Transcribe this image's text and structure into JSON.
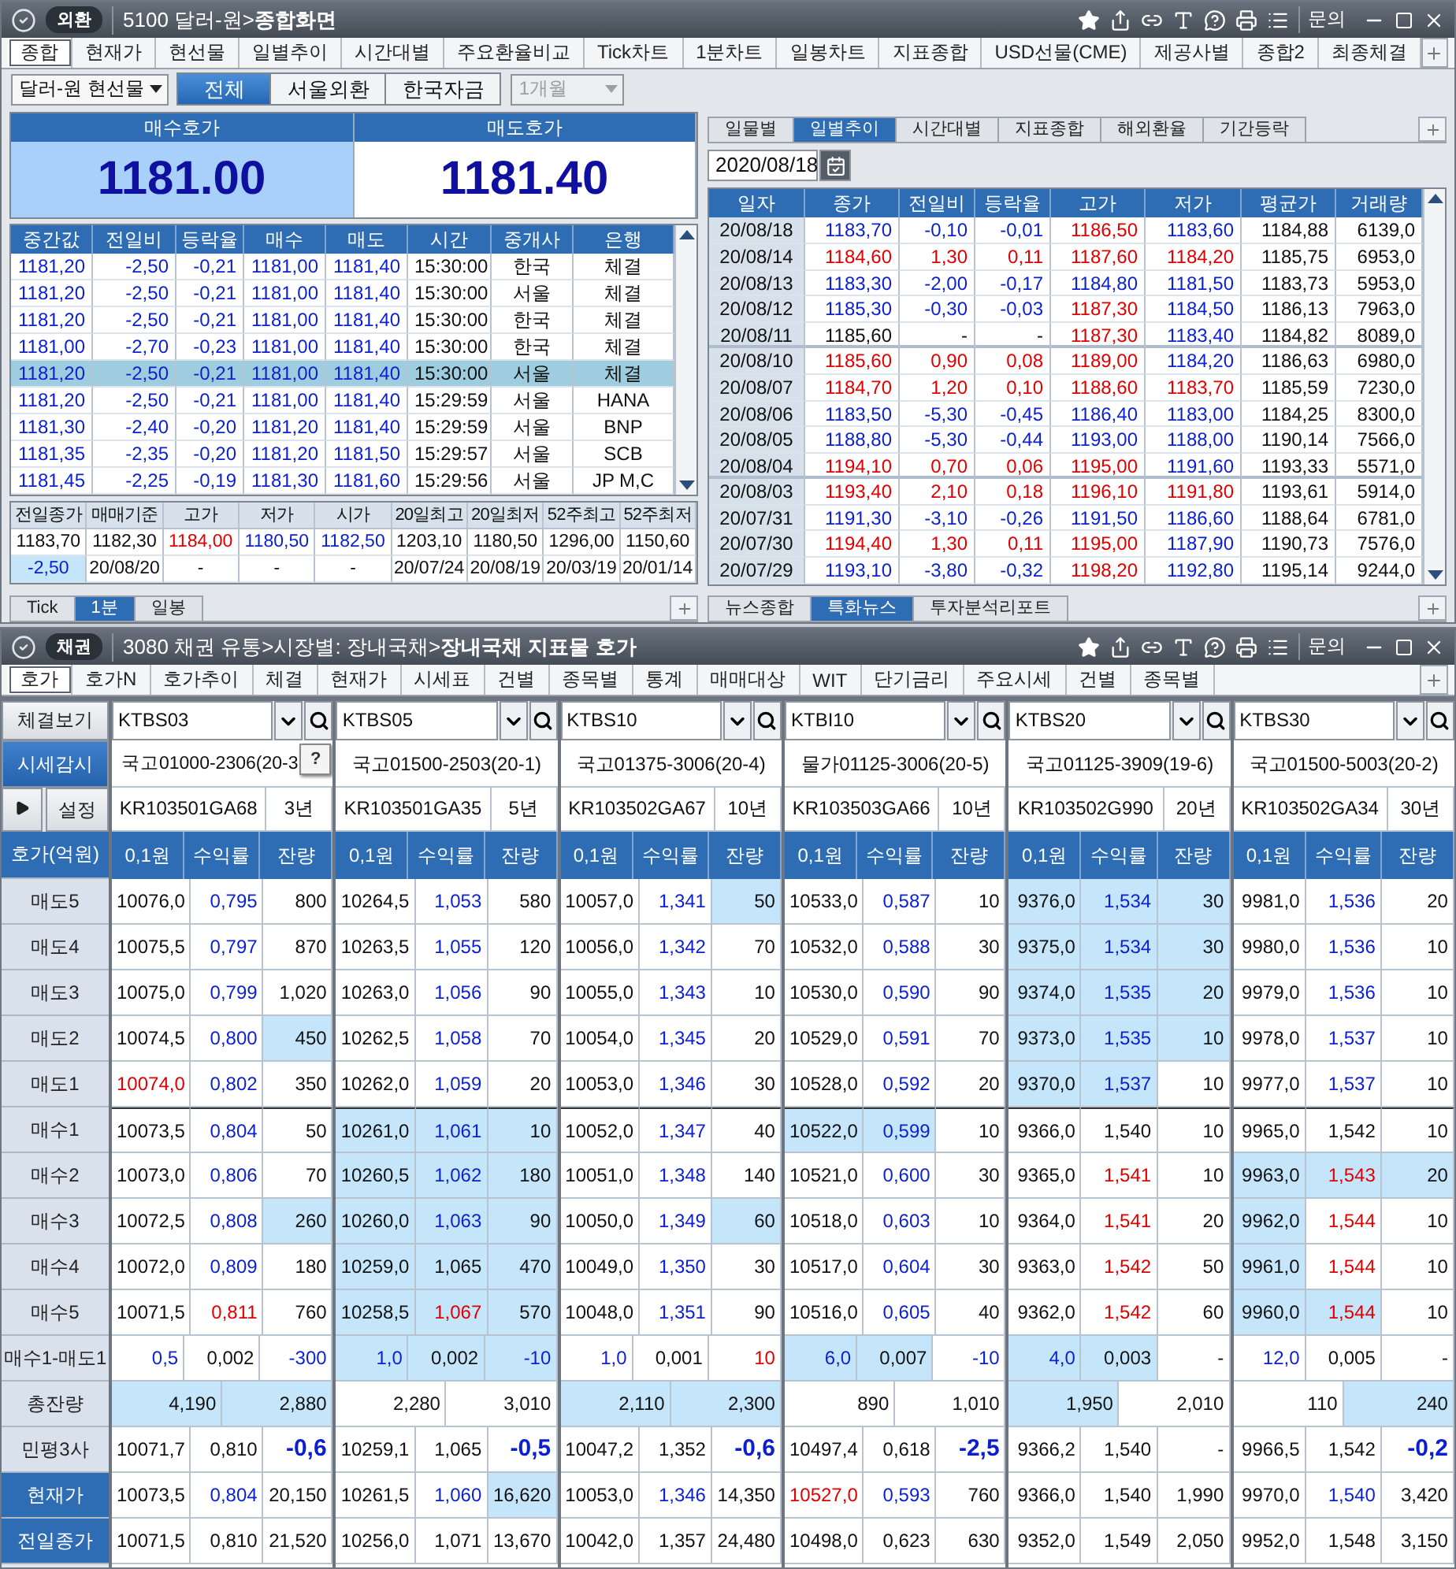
{
  "fx_window": {
    "badge": "외환",
    "title": "5100 달러-원>**종합화면**",
    "inquiry": "문의",
    "tabs": [
      {
        "label": "종합",
        "selected": true
      },
      {
        "label": "현재가",
        "selected": false
      },
      {
        "label": "현선물",
        "selected": false
      },
      {
        "label": "일별추이",
        "selected": false
      },
      {
        "label": "시간대별",
        "selected": false
      },
      {
        "label": "주요환율비교",
        "selected": false
      },
      {
        "label": "Tick차트",
        "selected": false
      },
      {
        "label": "1분차트",
        "selected": false
      },
      {
        "label": "일봉차트",
        "selected": false
      },
      {
        "label": "지표종합",
        "selected": false
      },
      {
        "label": "USD선물(CME)",
        "selected": false
      },
      {
        "label": "제공사별",
        "selected": false
      },
      {
        "label": "종합2",
        "selected": false
      },
      {
        "label": "최종체결",
        "selected": false
      }
    ],
    "instrument": "달러-원 현선물",
    "segments": [
      {
        "label": "전체",
        "selected": true
      },
      {
        "label": "서울외환",
        "selected": false
      },
      {
        "label": "한국자금",
        "selected": false
      }
    ],
    "period": {
      "value": "1개월",
      "disabled": true
    },
    "quotes": [
      {
        "label": "매수호가",
        "value": "1181.00",
        "highlighted": true
      },
      {
        "label": "매도호가",
        "value": "1181.40",
        "highlighted": false
      }
    ],
    "ticks": {
      "columns": [
        {
          "label": "중간값",
          "color": "#0a1fd0"
        },
        {
          "label": "전일비",
          "color": "#0a1fd0"
        },
        {
          "label": "등락율",
          "color": "#0a1fd0"
        },
        {
          "label": "매수",
          "color": "#0a1fd0"
        },
        {
          "label": "매도",
          "color": "#0a1fd0"
        },
        {
          "label": "시간",
          "color": "#111111"
        },
        {
          "label": "중개사",
          "color": "#111111"
        },
        {
          "label": "은행",
          "color": "#111111"
        }
      ],
      "rows": [
        {
          "cells": [
            "1181,20",
            "-2,50",
            "-0,21",
            "1181,00",
            "1181,40",
            "15:30:00",
            "한국",
            "체결"
          ],
          "selected": false
        },
        {
          "cells": [
            "1181,20",
            "-2,50",
            "-0,21",
            "1181,00",
            "1181,40",
            "15:30:00",
            "서울",
            "체결"
          ],
          "selected": false
        },
        {
          "cells": [
            "1181,20",
            "-2,50",
            "-0,21",
            "1181,00",
            "1181,40",
            "15:30:00",
            "한국",
            "체결"
          ],
          "selected": false
        },
        {
          "cells": [
            "1181,00",
            "-2,70",
            "-0,23",
            "1181,00",
            "1181,40",
            "15:30:00",
            "한국",
            "체결"
          ],
          "selected": false
        },
        {
          "cells": [
            "1181,20",
            "-2,50",
            "-0,21",
            "1181,00",
            "1181,40",
            "15:30:00",
            "서울",
            "체결"
          ],
          "selected": true
        },
        {
          "cells": [
            "1181,20",
            "-2,50",
            "-0,21",
            "1181,00",
            "1181,40",
            "15:29:59",
            "서울",
            "HANA"
          ],
          "selected": false
        },
        {
          "cells": [
            "1181,30",
            "-2,40",
            "-0,20",
            "1181,20",
            "1181,40",
            "15:29:59",
            "서울",
            "BNP"
          ],
          "selected": false
        },
        {
          "cells": [
            "1181,35",
            "-2,35",
            "-0,20",
            "1181,20",
            "1181,50",
            "15:29:57",
            "서울",
            "SCB"
          ],
          "selected": false
        },
        {
          "cells": [
            "1181,45",
            "-2,25",
            "-0,19",
            "1181,30",
            "1181,60",
            "15:29:56",
            "서울",
            "JP M,C"
          ],
          "selected": false
        }
      ]
    },
    "summary": {
      "columns": [
        "전일종가",
        "매매기준",
        "고가",
        "저가",
        "시가",
        "20일최고",
        "20일최저",
        "52주최고",
        "52주최저"
      ],
      "rows": [
        [
          "1183,70",
          "1182,30",
          {
            "text": "1184,00",
            "color": "#e00000"
          },
          {
            "text": "1180,50",
            "color": "#0a1fd0"
          },
          {
            "text": "1182,50",
            "color": "#0a1fd0"
          },
          "1203,10",
          "1180,50",
          "1296,00",
          "1150,60"
        ],
        [
          {
            "text": "-2,50",
            "color": "#0a1fd0",
            "highlighted": true
          },
          "20/08/20",
          "-",
          "-",
          "-",
          "20/07/24",
          "20/08/19",
          "20/03/19",
          "20/01/14"
        ]
      ]
    },
    "chart_tabs": [
      {
        "label": "Tick",
        "selected": false
      },
      {
        "label": "1분",
        "selected": true
      },
      {
        "label": "일봉",
        "selected": false
      }
    ],
    "daily": {
      "tabs": [
        {
          "label": "일물별",
          "selected": false
        },
        {
          "label": "일별추이",
          "selected": true
        },
        {
          "label": "시간대별",
          "selected": false
        },
        {
          "label": "지표종합",
          "selected": false
        },
        {
          "label": "해외환율",
          "selected": false
        },
        {
          "label": "기간등락",
          "selected": false
        }
      ],
      "date": "2020/08/18",
      "columns": [
        "일자",
        "종가",
        "전일비",
        "등락율",
        "고가",
        "저가",
        "평균가",
        "거래량"
      ],
      "rows": [
        [
          "20/08/18",
          {
            "text": "1183,70",
            "color": "#0a1fd0"
          },
          {
            "text": "-0,10",
            "color": "#0a1fd0"
          },
          {
            "text": "-0,01",
            "color": "#0a1fd0"
          },
          {
            "text": "1186,50",
            "color": "#e00000"
          },
          {
            "text": "1183,60",
            "color": "#0a1fd0"
          },
          "1184,88",
          "6139,0"
        ],
        [
          "20/08/14",
          {
            "text": "1184,60",
            "color": "#e00000"
          },
          {
            "text": "1,30",
            "color": "#e00000"
          },
          {
            "text": "0,11",
            "color": "#e00000"
          },
          {
            "text": "1187,60",
            "color": "#e00000"
          },
          {
            "text": "1184,20",
            "color": "#e00000"
          },
          "1185,75",
          "6953,0"
        ],
        [
          "20/08/13",
          {
            "text": "1183,30",
            "color": "#0a1fd0"
          },
          {
            "text": "-2,00",
            "color": "#0a1fd0"
          },
          {
            "text": "-0,17",
            "color": "#0a1fd0"
          },
          {
            "text": "1184,80",
            "color": "#0a1fd0"
          },
          {
            "text": "1181,50",
            "color": "#0a1fd0"
          },
          "1183,73",
          "5953,0"
        ],
        [
          "20/08/12",
          {
            "text": "1185,30",
            "color": "#0a1fd0"
          },
          {
            "text": "-0,30",
            "color": "#0a1fd0"
          },
          {
            "text": "-0,03",
            "color": "#0a1fd0"
          },
          {
            "text": "1187,30",
            "color": "#e00000"
          },
          {
            "text": "1184,50",
            "color": "#0a1fd0"
          },
          "1186,13",
          "7963,0"
        ],
        [
          "20/08/11",
          "1185,60",
          "-",
          "-",
          {
            "text": "1187,30",
            "color": "#e00000"
          },
          {
            "text": "1183,40",
            "color": "#0a1fd0"
          },
          "1184,82",
          "8089,0"
        ],
        [
          "20/08/10",
          {
            "text": "1185,60",
            "color": "#e00000"
          },
          {
            "text": "0,90",
            "color": "#e00000"
          },
          {
            "text": "0,08",
            "color": "#e00000"
          },
          {
            "text": "1189,00",
            "color": "#e00000"
          },
          {
            "text": "1184,20",
            "color": "#0a1fd0"
          },
          "1186,63",
          "6980,0"
        ],
        [
          "20/08/07",
          {
            "text": "1184,70",
            "color": "#e00000"
          },
          {
            "text": "1,20",
            "color": "#e00000"
          },
          {
            "text": "0,10",
            "color": "#e00000"
          },
          {
            "text": "1188,60",
            "color": "#e00000"
          },
          {
            "text": "1183,70",
            "color": "#e00000"
          },
          "1185,59",
          "7230,0"
        ],
        [
          "20/08/06",
          {
            "text": "1183,50",
            "color": "#0a1fd0"
          },
          {
            "text": "-5,30",
            "color": "#0a1fd0"
          },
          {
            "text": "-0,45",
            "color": "#0a1fd0"
          },
          {
            "text": "1186,40",
            "color": "#0a1fd0"
          },
          {
            "text": "1183,00",
            "color": "#0a1fd0"
          },
          "1184,25",
          "8300,0"
        ],
        [
          "20/08/05",
          {
            "text": "1188,80",
            "color": "#0a1fd0"
          },
          {
            "text": "-5,30",
            "color": "#0a1fd0"
          },
          {
            "text": "-0,44",
            "color": "#0a1fd0"
          },
          {
            "text": "1193,00",
            "color": "#0a1fd0"
          },
          {
            "text": "1188,00",
            "color": "#0a1fd0"
          },
          "1190,14",
          "7566,0"
        ],
        [
          "20/08/04",
          {
            "text": "1194,10",
            "color": "#e00000"
          },
          {
            "text": "0,70",
            "color": "#e00000"
          },
          {
            "text": "0,06",
            "color": "#e00000"
          },
          {
            "text": "1195,00",
            "color": "#e00000"
          },
          {
            "text": "1191,60",
            "color": "#0a1fd0"
          },
          "1193,33",
          "5571,0"
        ],
        [
          "20/08/03",
          {
            "text": "1193,40",
            "color": "#e00000"
          },
          {
            "text": "2,10",
            "color": "#e00000"
          },
          {
            "text": "0,18",
            "color": "#e00000"
          },
          {
            "text": "1196,10",
            "color": "#e00000"
          },
          {
            "text": "1191,80",
            "color": "#e00000"
          },
          "1193,61",
          "5914,0"
        ],
        [
          "20/07/31",
          {
            "text": "1191,30",
            "color": "#0a1fd0"
          },
          {
            "text": "-3,10",
            "color": "#0a1fd0"
          },
          {
            "text": "-0,26",
            "color": "#0a1fd0"
          },
          {
            "text": "1191,50",
            "color": "#0a1fd0"
          },
          {
            "text": "1186,60",
            "color": "#0a1fd0"
          },
          "1188,64",
          "6781,0"
        ],
        [
          "20/07/30",
          {
            "text": "1194,40",
            "color": "#e00000"
          },
          {
            "text": "1,30",
            "color": "#e00000"
          },
          {
            "text": "0,11",
            "color": "#e00000"
          },
          {
            "text": "1195,00",
            "color": "#e00000"
          },
          {
            "text": "1187,90",
            "color": "#0a1fd0"
          },
          "1190,73",
          "7576,0"
        ],
        [
          "20/07/29",
          {
            "text": "1193,10",
            "color": "#0a1fd0"
          },
          {
            "text": "-3,80",
            "color": "#0a1fd0"
          },
          {
            "text": "-0,32",
            "color": "#0a1fd0"
          },
          {
            "text": "1198,20",
            "color": "#e00000"
          },
          {
            "text": "1192,80",
            "color": "#0a1fd0"
          },
          "1195,14",
          "9244,0"
        ]
      ]
    },
    "news_tabs": [
      {
        "label": "뉴스종합",
        "selected": false
      },
      {
        "label": "특화뉴스",
        "selected": true
      },
      {
        "label": "투자분석리포트",
        "selected": false
      }
    ]
  },
  "bond_window": {
    "badge": "채권",
    "title": "3080 채권 유통>시장별: 장내국채>**장내국채 지표물 호가**",
    "inquiry": "문의",
    "tabs": [
      {
        "label": "호가",
        "selected": true
      },
      {
        "label": "호가N",
        "selected": false
      },
      {
        "label": "호가추이",
        "selected": false
      },
      {
        "label": "체결",
        "selected": false
      },
      {
        "label": "현재가",
        "selected": false
      },
      {
        "label": "시세표",
        "selected": false
      },
      {
        "label": "건별",
        "selected": false
      },
      {
        "label": "종목별",
        "selected": false
      },
      {
        "label": "통계",
        "selected": false
      },
      {
        "label": "매매대상",
        "selected": false
      },
      {
        "label": "WIT",
        "selected": false
      },
      {
        "label": "단기금리",
        "selected": false
      },
      {
        "label": "주요시세",
        "selected": false
      },
      {
        "label": "건별",
        "selected": false
      },
      {
        "label": "종목별",
        "selected": false
      }
    ],
    "trades_button": "체결보기",
    "watch_button": "시세감시",
    "settings_button": "설정",
    "header": "호가(억원)",
    "tooltip": "?",
    "row_labels": [
      {
        "label": "매도5",
        "kind": "label"
      },
      {
        "label": "매도4",
        "kind": "label"
      },
      {
        "label": "매도3",
        "kind": "label"
      },
      {
        "label": "매도2",
        "kind": "label"
      },
      {
        "label": "매도1",
        "kind": "label"
      },
      {
        "label": "매수1",
        "kind": "label"
      },
      {
        "label": "매수2",
        "kind": "label"
      },
      {
        "label": "매수3",
        "kind": "label"
      },
      {
        "label": "매수4",
        "kind": "label"
      },
      {
        "label": "매수5",
        "kind": "label"
      },
      {
        "label": "매수1-매도1",
        "kind": "label"
      },
      {
        "label": "총잔량",
        "kind": "label"
      },
      {
        "label": "민평3사",
        "kind": "label"
      },
      {
        "label": "현재가",
        "kind": "button"
      },
      {
        "label": "전일종가",
        "kind": "button"
      }
    ],
    "columns": [
      {
        "code": "KTBS03",
        "name": "국고01000-2306(20-3",
        "isin": "KR103501GA68",
        "tenor": "3년",
        "headers": [
          "0,1원",
          "수익률",
          "잔량"
        ],
        "totals": [
          {
            "text": "4,190",
            "highlighted": true
          },
          {
            "text": "2,880",
            "highlighted": true
          }
        ],
        "rows": [
          [
            "10076,0",
            {
              "text": "0,795",
              "color": "#0a1fd0"
            },
            "800"
          ],
          [
            "10075,5",
            {
              "text": "0,797",
              "color": "#0a1fd0"
            },
            "870"
          ],
          [
            "10075,0",
            {
              "text": "0,799",
              "color": "#0a1fd0"
            },
            "1,020"
          ],
          [
            "10074,5",
            {
              "text": "0,800",
              "color": "#0a1fd0"
            },
            {
              "text": "450",
              "highlighted": true
            }
          ],
          [
            {
              "text": "10074,0",
              "color": "#e00000"
            },
            {
              "text": "0,802",
              "color": "#0a1fd0"
            },
            "350"
          ],
          [
            "10073,5",
            {
              "text": "0,804",
              "color": "#0a1fd0"
            },
            "50"
          ],
          [
            "10073,0",
            {
              "text": "0,806",
              "color": "#0a1fd0"
            },
            "70"
          ],
          [
            "10072,5",
            {
              "text": "0,808",
              "color": "#0a1fd0"
            },
            {
              "text": "260",
              "highlighted": true
            }
          ],
          [
            "10072,0",
            {
              "text": "0,809",
              "color": "#0a1fd0"
            },
            "180"
          ],
          [
            "10071,5",
            {
              "text": "0,811",
              "color": "#e00000"
            },
            "760"
          ],
          [
            {
              "text": "0,5",
              "color": "#0a1fd0"
            },
            "0,002",
            {
              "text": "-300",
              "color": "#0a1fd0"
            }
          ],
          [
            "10071,7",
            "0,810",
            {
              "text": "-0,6",
              "color": "#0a1fd0",
              "bold": true
            }
          ],
          [
            "10073,5",
            {
              "text": "0,804",
              "color": "#0a1fd0"
            },
            "20,150"
          ],
          [
            "10071,5",
            "0,810",
            "21,520"
          ]
        ]
      },
      {
        "code": "KTBS05",
        "name": "국고01500-2503(20-1)",
        "isin": "KR103501GA35",
        "tenor": "5년",
        "headers": [
          "0,1원",
          "수익률",
          "잔량"
        ],
        "totals": [
          {
            "text": "2,280",
            "highlighted": false
          },
          {
            "text": "3,010",
            "highlighted": false
          }
        ],
        "rows": [
          [
            "10264,5",
            {
              "text": "1,053",
              "color": "#0a1fd0"
            },
            "580"
          ],
          [
            "10263,5",
            {
              "text": "1,055",
              "color": "#0a1fd0"
            },
            "120"
          ],
          [
            "10263,0",
            {
              "text": "1,056",
              "color": "#0a1fd0"
            },
            "90"
          ],
          [
            "10262,5",
            {
              "text": "1,058",
              "color": "#0a1fd0"
            },
            "70"
          ],
          [
            "10262,0",
            {
              "text": "1,059",
              "color": "#0a1fd0"
            },
            "20"
          ],
          [
            {
              "text": "10261,0",
              "highlighted": true
            },
            {
              "text": "1,061",
              "color": "#0a1fd0",
              "highlighted": true
            },
            {
              "text": "10",
              "highlighted": true
            }
          ],
          [
            {
              "text": "10260,5",
              "highlighted": true
            },
            {
              "text": "1,062",
              "color": "#0a1fd0",
              "highlighted": true
            },
            {
              "text": "180",
              "highlighted": true
            }
          ],
          [
            {
              "text": "10260,0",
              "highlighted": true
            },
            {
              "text": "1,063",
              "color": "#0a1fd0",
              "highlighted": true
            },
            {
              "text": "90",
              "highlighted": true
            }
          ],
          [
            {
              "text": "10259,0",
              "highlighted": true
            },
            {
              "text": "1,065",
              "highlighted": true
            },
            {
              "text": "470",
              "highlighted": true
            }
          ],
          [
            {
              "text": "10258,5",
              "highlighted": true
            },
            {
              "text": "1,067",
              "color": "#e00000",
              "highlighted": true
            },
            {
              "text": "570",
              "highlighted": true
            }
          ],
          [
            {
              "text": "1,0",
              "color": "#0a1fd0",
              "highlighted": true
            },
            {
              "text": "0,002",
              "highlighted": true
            },
            {
              "text": "-10",
              "color": "#0a1fd0",
              "highlighted": true
            }
          ],
          [
            "10259,1",
            "1,065",
            {
              "text": "-0,5",
              "color": "#0a1fd0",
              "bold": true
            }
          ],
          [
            "10261,5",
            {
              "text": "1,060",
              "color": "#0a1fd0"
            },
            {
              "text": "16,620",
              "highlighted": true
            }
          ],
          [
            "10256,0",
            "1,071",
            "13,670"
          ]
        ]
      },
      {
        "code": "KTBS10",
        "name": "국고01375-3006(20-4)",
        "isin": "KR103502GA67",
        "tenor": "10년",
        "headers": [
          "0,1원",
          "수익률",
          "잔량"
        ],
        "totals": [
          {
            "text": "2,110",
            "highlighted": true
          },
          {
            "text": "2,300",
            "highlighted": true
          }
        ],
        "rows": [
          [
            "10057,0",
            {
              "text": "1,341",
              "color": "#0a1fd0"
            },
            {
              "text": "50",
              "highlighted": true
            }
          ],
          [
            "10056,0",
            {
              "text": "1,342",
              "color": "#0a1fd0"
            },
            "70"
          ],
          [
            "10055,0",
            {
              "text": "1,343",
              "color": "#0a1fd0"
            },
            "10"
          ],
          [
            "10054,0",
            {
              "text": "1,345",
              "color": "#0a1fd0"
            },
            "20"
          ],
          [
            "10053,0",
            {
              "text": "1,346",
              "color": "#0a1fd0"
            },
            "30"
          ],
          [
            "10052,0",
            {
              "text": "1,347",
              "color": "#0a1fd0"
            },
            "40"
          ],
          [
            "10051,0",
            {
              "text": "1,348",
              "color": "#0a1fd0"
            },
            "140"
          ],
          [
            "10050,0",
            {
              "text": "1,349",
              "color": "#0a1fd0"
            },
            {
              "text": "60",
              "highlighted": true
            }
          ],
          [
            "10049,0",
            {
              "text": "1,350",
              "color": "#0a1fd0"
            },
            "30"
          ],
          [
            "10048,0",
            {
              "text": "1,351",
              "color": "#0a1fd0"
            },
            "90"
          ],
          [
            {
              "text": "1,0",
              "color": "#0a1fd0"
            },
            "0,001",
            {
              "text": "10",
              "color": "#e00000"
            }
          ],
          [
            "10047,2",
            "1,352",
            {
              "text": "-0,6",
              "color": "#0a1fd0",
              "bold": true
            }
          ],
          [
            "10053,0",
            {
              "text": "1,346",
              "color": "#0a1fd0"
            },
            "14,350"
          ],
          [
            "10042,0",
            "1,357",
            "24,480"
          ]
        ]
      },
      {
        "code": "KTBI10",
        "name": "물가01125-3006(20-5)",
        "isin": "KR103503GA66",
        "tenor": "10년",
        "headers": [
          "0,1원",
          "수익률",
          "잔량"
        ],
        "totals": [
          {
            "text": "890",
            "highlighted": false
          },
          {
            "text": "1,010",
            "highlighted": false
          }
        ],
        "rows": [
          [
            "10533,0",
            {
              "text": "0,587",
              "color": "#0a1fd0"
            },
            "10"
          ],
          [
            "10532,0",
            {
              "text": "0,588",
              "color": "#0a1fd0"
            },
            "30"
          ],
          [
            "10530,0",
            {
              "text": "0,590",
              "color": "#0a1fd0"
            },
            "90"
          ],
          [
            "10529,0",
            {
              "text": "0,591",
              "color": "#0a1fd0"
            },
            "70"
          ],
          [
            "10528,0",
            {
              "text": "0,592",
              "color": "#0a1fd0"
            },
            "20"
          ],
          [
            {
              "text": "10522,0",
              "highlighted": true
            },
            {
              "text": "0,599",
              "color": "#0a1fd0",
              "highlighted": true
            },
            "10"
          ],
          [
            "10521,0",
            {
              "text": "0,600",
              "color": "#0a1fd0"
            },
            "30"
          ],
          [
            "10518,0",
            {
              "text": "0,603",
              "color": "#0a1fd0"
            },
            "10"
          ],
          [
            "10517,0",
            {
              "text": "0,604",
              "color": "#0a1fd0"
            },
            "30"
          ],
          [
            "10516,0",
            {
              "text": "0,605",
              "color": "#0a1fd0"
            },
            "40"
          ],
          [
            {
              "text": "6,0",
              "color": "#0a1fd0",
              "highlighted": true
            },
            {
              "text": "0,007",
              "highlighted": true
            },
            {
              "text": "-10",
              "color": "#0a1fd0"
            }
          ],
          [
            "10497,4",
            "0,618",
            {
              "text": "-2,5",
              "color": "#0a1fd0",
              "bold": true
            }
          ],
          [
            {
              "text": "10527,0",
              "color": "#e00000"
            },
            {
              "text": "0,593",
              "color": "#0a1fd0"
            },
            "760"
          ],
          [
            "10498,0",
            "0,623",
            "630"
          ]
        ]
      },
      {
        "code": "KTBS20",
        "name": "국고01125-3909(19-6)",
        "isin": "KR103502G990",
        "tenor": "20년",
        "headers": [
          "0,1원",
          "수익률",
          "잔량"
        ],
        "totals": [
          {
            "text": "1,950",
            "highlighted": true
          },
          {
            "text": "2,010",
            "highlighted": false
          }
        ],
        "rows": [
          [
            {
              "text": "9376,0",
              "highlighted": true
            },
            {
              "text": "1,534",
              "color": "#0a1fd0",
              "highlighted": true
            },
            {
              "text": "30",
              "highlighted": true
            }
          ],
          [
            {
              "text": "9375,0",
              "highlighted": true
            },
            {
              "text": "1,534",
              "color": "#0a1fd0",
              "highlighted": true
            },
            {
              "text": "30",
              "highlighted": true
            }
          ],
          [
            {
              "text": "9374,0",
              "highlighted": true
            },
            {
              "text": "1,535",
              "color": "#0a1fd0",
              "highlighted": true
            },
            {
              "text": "20",
              "highlighted": true
            }
          ],
          [
            {
              "text": "9373,0",
              "highlighted": true
            },
            {
              "text": "1,535",
              "color": "#0a1fd0",
              "highlighted": true
            },
            {
              "text": "10",
              "highlighted": true
            }
          ],
          [
            {
              "text": "9370,0",
              "highlighted": true
            },
            {
              "text": "1,537",
              "color": "#0a1fd0",
              "highlighted": true
            },
            "10"
          ],
          [
            "9366,0",
            "1,540",
            "10"
          ],
          [
            "9365,0",
            {
              "text": "1,541",
              "color": "#e00000"
            },
            "10"
          ],
          [
            "9364,0",
            {
              "text": "1,541",
              "color": "#e00000"
            },
            "20"
          ],
          [
            "9363,0",
            {
              "text": "1,542",
              "color": "#e00000"
            },
            "50"
          ],
          [
            "9362,0",
            {
              "text": "1,542",
              "color": "#e00000"
            },
            "60"
          ],
          [
            {
              "text": "4,0",
              "color": "#0a1fd0",
              "highlighted": true
            },
            {
              "text": "0,003",
              "highlighted": true
            },
            "-"
          ],
          [
            "9366,2",
            "1,540",
            "-"
          ],
          [
            "9366,0",
            "1,540",
            "1,990"
          ],
          [
            "9352,0",
            "1,549",
            "2,050"
          ]
        ]
      },
      {
        "code": "KTBS30",
        "name": "국고01500-5003(20-2)",
        "isin": "KR103502GA34",
        "tenor": "30년",
        "headers": [
          "0,1원",
          "수익률",
          "잔량"
        ],
        "totals": [
          {
            "text": "110",
            "highlighted": false
          },
          {
            "text": "240",
            "highlighted": true
          }
        ],
        "rows": [
          [
            "9981,0",
            {
              "text": "1,536",
              "color": "#0a1fd0"
            },
            "20"
          ],
          [
            "9980,0",
            {
              "text": "1,536",
              "color": "#0a1fd0"
            },
            "10"
          ],
          [
            "9979,0",
            {
              "text": "1,536",
              "color": "#0a1fd0"
            },
            "10"
          ],
          [
            "9978,0",
            {
              "text": "1,537",
              "color": "#0a1fd0"
            },
            "10"
          ],
          [
            "9977,0",
            {
              "text": "1,537",
              "color": "#0a1fd0"
            },
            "10"
          ],
          [
            "9965,0",
            "1,542",
            "10"
          ],
          [
            {
              "text": "9963,0",
              "highlighted": true
            },
            {
              "text": "1,543",
              "color": "#e00000",
              "highlighted": true
            },
            {
              "text": "20",
              "highlighted": true
            }
          ],
          [
            {
              "text": "9962,0",
              "highlighted": true
            },
            {
              "text": "1,544",
              "color": "#e00000"
            },
            "10"
          ],
          [
            {
              "text": "9961,0",
              "highlighted": true
            },
            {
              "text": "1,544",
              "color": "#e00000"
            },
            "10"
          ],
          [
            {
              "text": "9960,0",
              "highlighted": true
            },
            {
              "text": "1,544",
              "color": "#e00000",
              "highlighted": true
            },
            "10"
          ],
          [
            {
              "text": "12,0",
              "color": "#0a1fd0"
            },
            "0,005",
            "-"
          ],
          [
            "9966,5",
            "1,542",
            {
              "text": "-0,2",
              "color": "#0a1fd0",
              "bold": true
            }
          ],
          [
            "9970,0",
            {
              "text": "1,540",
              "color": "#0a1fd0"
            },
            "3,420"
          ],
          [
            "9952,0",
            "1,548",
            "3,150"
          ]
        ]
      }
    ]
  }
}
